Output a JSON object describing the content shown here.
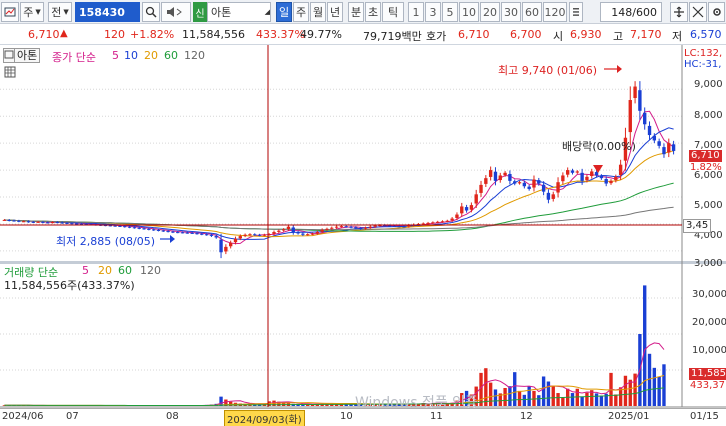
{
  "toolbar": {
    "market_label": "주",
    "type_label": "전",
    "code": "158430",
    "name_badge": "신",
    "name": "아톤",
    "periods": [
      "일",
      "주",
      "월",
      "년",
      "분",
      "초",
      "틱"
    ],
    "active_period": "일",
    "intervals": [
      "1",
      "3",
      "5",
      "10",
      "20",
      "30",
      "60",
      "120"
    ],
    "count": "148/600"
  },
  "quote": {
    "price": "6,710",
    "change_arrow": "▲",
    "change": "120",
    "change_pct": "+1.82%",
    "volume": "11,584,556",
    "volume_ratio": "433.37%",
    "turnover": "49.77%",
    "amount": "79,719백만",
    "bid_label": "호가",
    "ask": "6,710",
    "bid": "6,700",
    "open_label": "시",
    "open": "6,930",
    "high_label": "고",
    "high": "7,170",
    "low_label": "저",
    "low": "6,570"
  },
  "price_pane": {
    "name_tag": "아톤",
    "ma_label": "종가 단순",
    "ma_periods": [
      "5",
      "10",
      "20",
      "60",
      "120"
    ],
    "right_top_1": "LC:132,",
    "right_top_2": "HC:-31,",
    "high_annotation": "최고 9,740 (01/06)",
    "low_annotation": "최저 2,885 (08/05)",
    "dividend_annotation": "배당락(0.00%)",
    "price_badge": "6,710",
    "pct_badge": "1.82%",
    "ref_badge": "3,45",
    "y_ticks": [
      "9,000",
      "8,000",
      "7,000",
      "6,000",
      "5,000",
      "4,000",
      "3,000"
    ]
  },
  "volume_pane": {
    "label": "거래량 단순",
    "ma_periods": [
      "5",
      "20",
      "60",
      "120"
    ],
    "value_label": "11,584,556주(433.37%)",
    "y_ticks": [
      "30,000",
      "20,000",
      "10,000"
    ],
    "vol_badge": "11,585",
    "ratio_badge": "433,37"
  },
  "x_axis": {
    "ticks": [
      "2024/06",
      "07",
      "08",
      "10",
      "11",
      "12",
      "2025/01",
      "01/15"
    ],
    "crosshair_label": "2024/09/03(화)"
  },
  "watermark": "Windows 정품 인증\n[설정]으로 이동하여 Windows를 정품 인증합니다.",
  "chart_data": {
    "type": "candlestick",
    "y_range": [
      2700,
      9900
    ],
    "volume_range": [
      0,
      35000
    ],
    "close_series": [
      4150,
      4130,
      4120,
      4100,
      4100,
      4080,
      4070,
      4080,
      4060,
      4050,
      4070,
      4060,
      4040,
      4030,
      4020,
      4010,
      4000,
      3990,
      3980,
      3970,
      3960,
      3950,
      3940,
      3930,
      3920,
      3900,
      3880,
      3860,
      3840,
      3820,
      3800,
      3780,
      3760,
      3740,
      3720,
      3700,
      3690,
      3680,
      3670,
      3660,
      3640,
      3620,
      3600,
      3560,
      3500,
      2950,
      3150,
      3300,
      3450,
      3550,
      3600,
      3620,
      3600,
      3580,
      3600,
      3620,
      3700,
      3750,
      3800,
      3900,
      3700,
      3650,
      3600,
      3620,
      3640,
      3700,
      3780,
      3820,
      3860,
      3900,
      3920,
      3900,
      3880,
      3850,
      3820,
      3860,
      3900,
      3940,
      3960,
      3950,
      3930,
      3920,
      3910,
      3900,
      3950,
      3980,
      4000,
      4020,
      4040,
      4060,
      4080,
      4100,
      4120,
      4200,
      4350,
      4650,
      4500,
      4700,
      5100,
      5450,
      5700,
      6000,
      5600,
      5800,
      5900,
      5600,
      5500,
      5550,
      5400,
      5300,
      5650,
      5500,
      5200,
      4900,
      5100,
      5550,
      5800,
      6000,
      5900,
      5950,
      5600,
      5750,
      5950,
      5800,
      5700,
      5500,
      5600,
      5750,
      6200,
      7200,
      8600,
      9100,
      8200,
      7700,
      7300,
      7100,
      6900,
      6590,
      7000,
      6710
    ],
    "volume_series": [
      200,
      200,
      200,
      180,
      180,
      150,
      150,
      150,
      150,
      150,
      150,
      150,
      150,
      140,
      140,
      140,
      140,
      140,
      140,
      140,
      140,
      140,
      140,
      140,
      140,
      140,
      140,
      140,
      140,
      140,
      140,
      140,
      140,
      140,
      140,
      140,
      140,
      140,
      140,
      140,
      140,
      140,
      300,
      400,
      600,
      2600,
      1800,
      1200,
      900,
      700,
      600,
      500,
      600,
      700,
      600,
      1300,
      1500,
      1200,
      900,
      800,
      600,
      600,
      500,
      500,
      500,
      500,
      600,
      600,
      500,
      500,
      500,
      500,
      500,
      500,
      500,
      500,
      600,
      600,
      600,
      500,
      500,
      500,
      500,
      500,
      500,
      600,
      700,
      800,
      800,
      700,
      700,
      700,
      700,
      900,
      1500,
      3600,
      4200,
      3200,
      5400,
      9200,
      10500,
      6500,
      4600,
      3500,
      5000,
      5500,
      9400,
      4200,
      3100,
      5500,
      4200,
      3000,
      8200,
      6800,
      5600,
      3600,
      2300,
      4800,
      3600,
      4800,
      2500,
      3700,
      4400,
      3500,
      2900,
      3400,
      9200,
      3200,
      5200,
      8400,
      7300,
      9000,
      20000,
      33500,
      14500,
      10600,
      8100,
      11585
    ]
  }
}
